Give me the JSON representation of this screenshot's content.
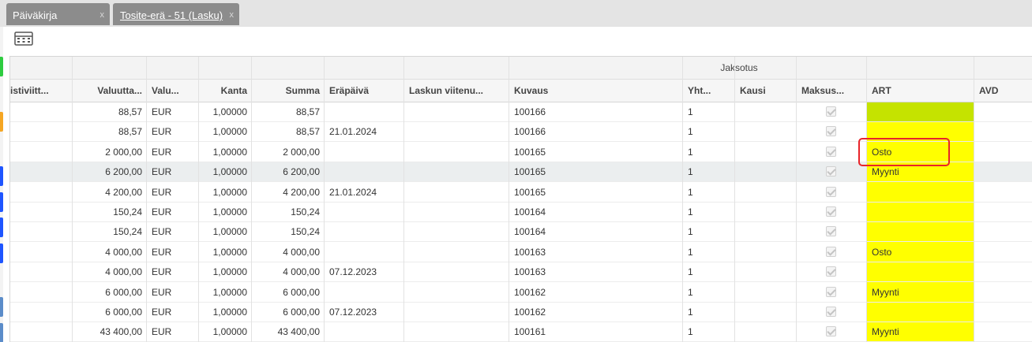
{
  "tabs": [
    {
      "label": "Päiväkirja",
      "close": "x"
    },
    {
      "label": "Tosite-erä - 51 (Lasku)",
      "close": "x"
    }
  ],
  "toolbar": {
    "button_icon": "grid-columns-icon"
  },
  "header_group": {
    "jaksotus": "Jaksotus"
  },
  "columns": [
    "istiviitt...",
    "Valuutta...",
    "Valu...",
    "Kanta",
    "Summa",
    "Eräpäivä",
    "Laskun viitenu...",
    "Kuvaus",
    "Yht...",
    "Kausi",
    "Maksus...",
    "ART",
    "AVD"
  ],
  "rows": [
    {
      "valuutta": "88,57",
      "valu": "EUR",
      "kanta": "1,00000",
      "summa": "88,57",
      "erapaiva": "",
      "kuvaus": "100166",
      "yht": "1",
      "art": ""
    },
    {
      "valuutta": "88,57",
      "valu": "EUR",
      "kanta": "1,00000",
      "summa": "88,57",
      "erapaiva": "21.01.2024",
      "kuvaus": "100166",
      "yht": "1",
      "art": ""
    },
    {
      "valuutta": "2 000,00",
      "valu": "EUR",
      "kanta": "1,00000",
      "summa": "2 000,00",
      "erapaiva": "",
      "kuvaus": "100165",
      "yht": "1",
      "art": "Osto"
    },
    {
      "valuutta": "6 200,00",
      "valu": "EUR",
      "kanta": "1,00000",
      "summa": "6 200,00",
      "erapaiva": "",
      "kuvaus": "100165",
      "yht": "1",
      "art": "Myynti"
    },
    {
      "valuutta": "4 200,00",
      "valu": "EUR",
      "kanta": "1,00000",
      "summa": "4 200,00",
      "erapaiva": "21.01.2024",
      "kuvaus": "100165",
      "yht": "1",
      "art": ""
    },
    {
      "valuutta": "150,24",
      "valu": "EUR",
      "kanta": "1,00000",
      "summa": "150,24",
      "erapaiva": "",
      "kuvaus": "100164",
      "yht": "1",
      "art": ""
    },
    {
      "valuutta": "150,24",
      "valu": "EUR",
      "kanta": "1,00000",
      "summa": "150,24",
      "erapaiva": "",
      "kuvaus": "100164",
      "yht": "1",
      "art": ""
    },
    {
      "valuutta": "4 000,00",
      "valu": "EUR",
      "kanta": "1,00000",
      "summa": "4 000,00",
      "erapaiva": "",
      "kuvaus": "100163",
      "yht": "1",
      "art": "Osto"
    },
    {
      "valuutta": "4 000,00",
      "valu": "EUR",
      "kanta": "1,00000",
      "summa": "4 000,00",
      "erapaiva": "07.12.2023",
      "kuvaus": "100163",
      "yht": "1",
      "art": ""
    },
    {
      "valuutta": "6 000,00",
      "valu": "EUR",
      "kanta": "1,00000",
      "summa": "6 000,00",
      "erapaiva": "",
      "kuvaus": "100162",
      "yht": "1",
      "art": "Myynti"
    },
    {
      "valuutta": "6 000,00",
      "valu": "EUR",
      "kanta": "1,00000",
      "summa": "6 000,00",
      "erapaiva": "07.12.2023",
      "kuvaus": "100162",
      "yht": "1",
      "art": ""
    },
    {
      "valuutta": "43 400,00",
      "valu": "EUR",
      "kanta": "1,00000",
      "summa": "43 400,00",
      "erapaiva": "",
      "kuvaus": "100161",
      "yht": "1",
      "art": "Myynti"
    }
  ],
  "colors": {
    "art_highlight": "#ffff00",
    "art_selected": "#c5e300",
    "annotation": "#e8242a",
    "tab_bg": "#8c8c8c"
  }
}
